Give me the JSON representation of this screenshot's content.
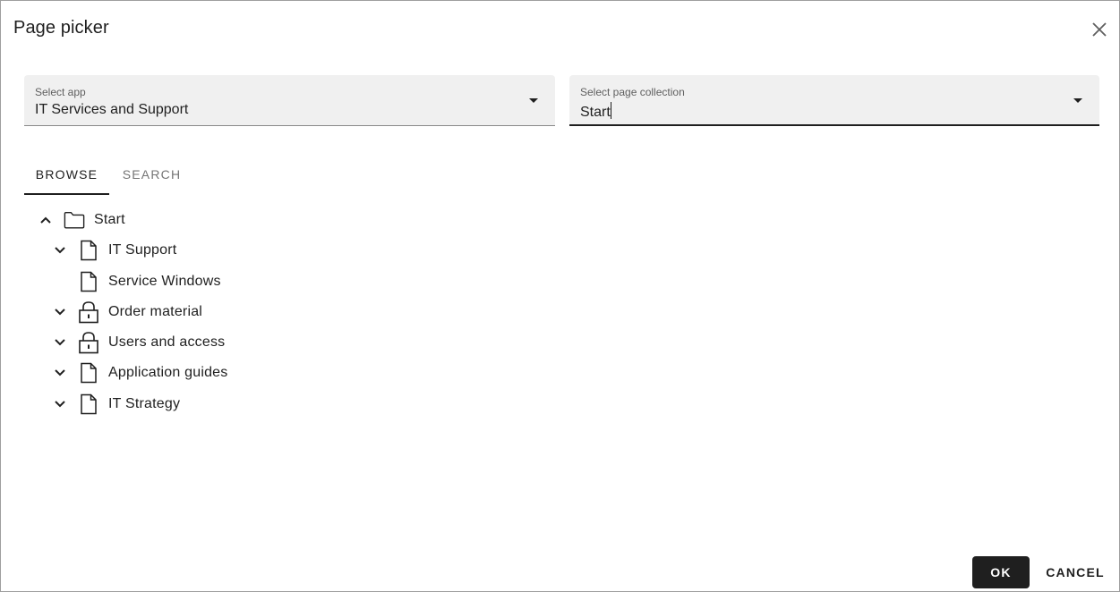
{
  "dialog": {
    "title": "Page picker"
  },
  "select_app": {
    "label": "Select app",
    "value": "IT Services and Support"
  },
  "select_collection": {
    "label": "Select page collection",
    "value": "Start"
  },
  "tabs": [
    {
      "label": "BROWSE",
      "active": true
    },
    {
      "label": "SEARCH",
      "active": false
    }
  ],
  "tree": [
    {
      "label": "Start",
      "icon": "folder-icon",
      "expander": "chevron-up-icon",
      "depth": 0
    },
    {
      "label": "IT Support",
      "icon": "page-icon",
      "expander": "chevron-down-icon",
      "depth": 1
    },
    {
      "label": "Service Windows",
      "icon": "page-icon",
      "expander": "none",
      "depth": 1
    },
    {
      "label": "Order material",
      "icon": "lock-icon",
      "expander": "chevron-down-icon",
      "depth": 1
    },
    {
      "label": "Users and access",
      "icon": "lock-icon",
      "expander": "chevron-down-icon",
      "depth": 1
    },
    {
      "label": "Application guides",
      "icon": "page-icon",
      "expander": "chevron-down-icon",
      "depth": 1
    },
    {
      "label": "IT Strategy",
      "icon": "page-icon",
      "expander": "chevron-down-icon",
      "depth": 1
    }
  ],
  "actions": {
    "ok": "OK",
    "cancel": "CANCEL"
  },
  "colors": {
    "primary": "#1f1f1f",
    "field_bg": "#f0f0f0",
    "muted": "#757575"
  }
}
